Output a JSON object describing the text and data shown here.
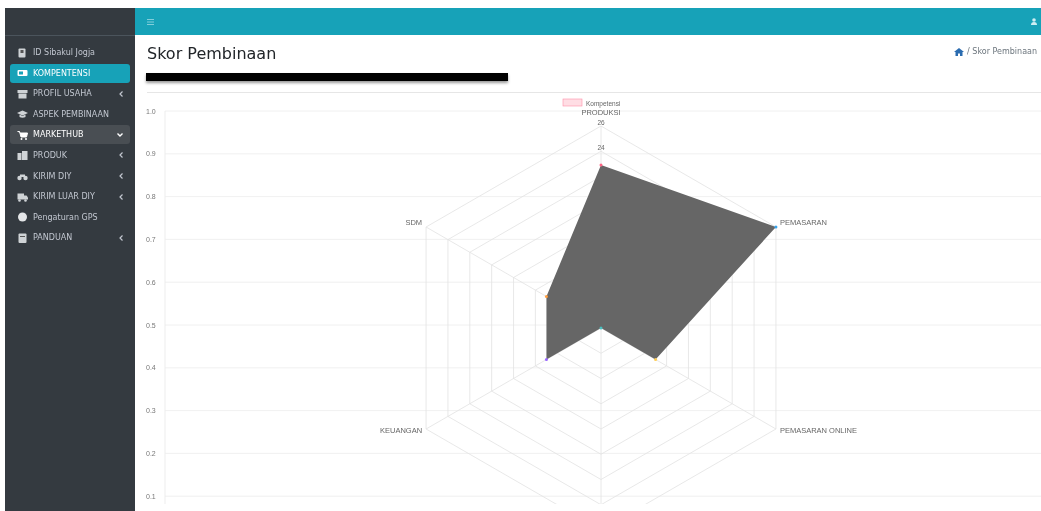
{
  "sidebar": {
    "items": [
      {
        "label": "ID Sibakul Jogja",
        "selected": false,
        "has_submenu": false,
        "expanded": false
      },
      {
        "label": "KOMPENTENSI",
        "selected": true,
        "has_submenu": false,
        "expanded": false
      },
      {
        "label": "PROFIL USAHA",
        "selected": false,
        "has_submenu": true,
        "expanded": false
      },
      {
        "label": "ASPEK PEMBINAAN",
        "selected": false,
        "has_submenu": false,
        "expanded": false
      },
      {
        "label": "MARKETHUB",
        "selected": false,
        "has_submenu": true,
        "expanded": true
      },
      {
        "label": "PRODUK",
        "selected": false,
        "has_submenu": true,
        "expanded": false
      },
      {
        "label": "KIRIM DIY",
        "selected": false,
        "has_submenu": true,
        "expanded": false
      },
      {
        "label": "KIRIM LUAR DIY",
        "selected": false,
        "has_submenu": true,
        "expanded": false
      },
      {
        "label": "Pengaturan GPS",
        "selected": false,
        "has_submenu": false,
        "expanded": false
      },
      {
        "label": "PANDUAN",
        "selected": false,
        "has_submenu": true,
        "expanded": false
      }
    ]
  },
  "page": {
    "title": "Skor Pembinaan",
    "breadcrumb": "/ Skor Pembinaan"
  },
  "chart": {
    "y_axis_labels": [
      "1.0",
      "0.9",
      "0.8",
      "0.7",
      "0.6",
      "0.5",
      "0.4",
      "0.3",
      "0.2",
      "0.1"
    ],
    "legend": "Kompetensi",
    "radar_scale_labels": [
      "26",
      "24"
    ],
    "radar_axis_labels": [
      "PRODUKSI",
      "SDM",
      "PEMASARAN",
      "KEUANGAN",
      "PEMASARAN ONLINE"
    ]
  }
}
